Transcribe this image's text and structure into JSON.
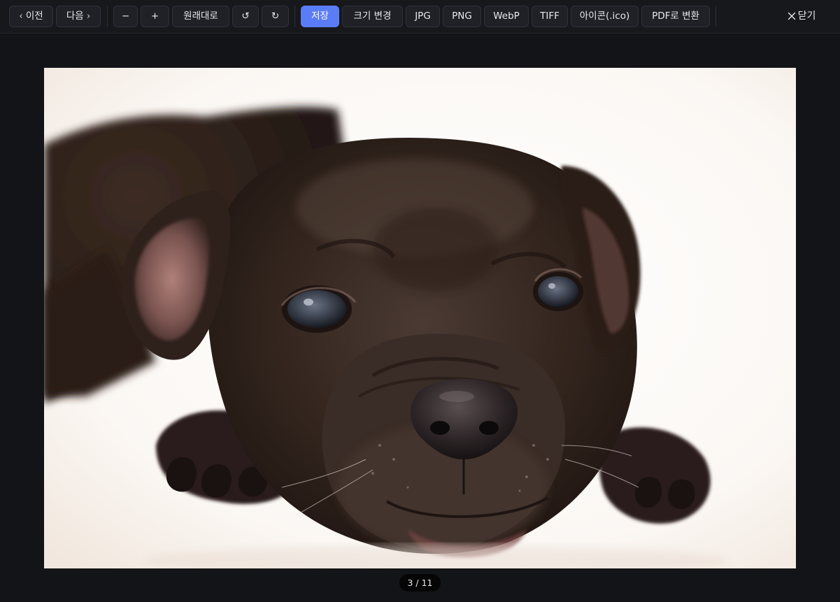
{
  "toolbar": {
    "prev_label": "이전",
    "next_label": "다음",
    "zoom_out_label": "−",
    "zoom_in_label": "+",
    "original_label": "원래대로",
    "rotate_left_label": "↺",
    "rotate_right_label": "↻",
    "save_label": "저장",
    "resize_label": "크기 변경",
    "jpg_label": "JPG",
    "png_label": "PNG",
    "webp_label": "WebP",
    "tiff_label": "TIFF",
    "ico_label": "아이콘(.ico)",
    "pdf_label": "PDF로 변환",
    "close_label": "닫기"
  },
  "icons": {
    "prev": "chevron-left-icon",
    "next": "chevron-right-icon",
    "close": "close-icon",
    "rotate_left": "rotate-left-icon",
    "rotate_right": "rotate-right-icon"
  },
  "viewer": {
    "counter": "3 / 11"
  },
  "colors": {
    "accent": "#5b7cf7",
    "background": "#131417",
    "button_bg": "#1f2127"
  }
}
